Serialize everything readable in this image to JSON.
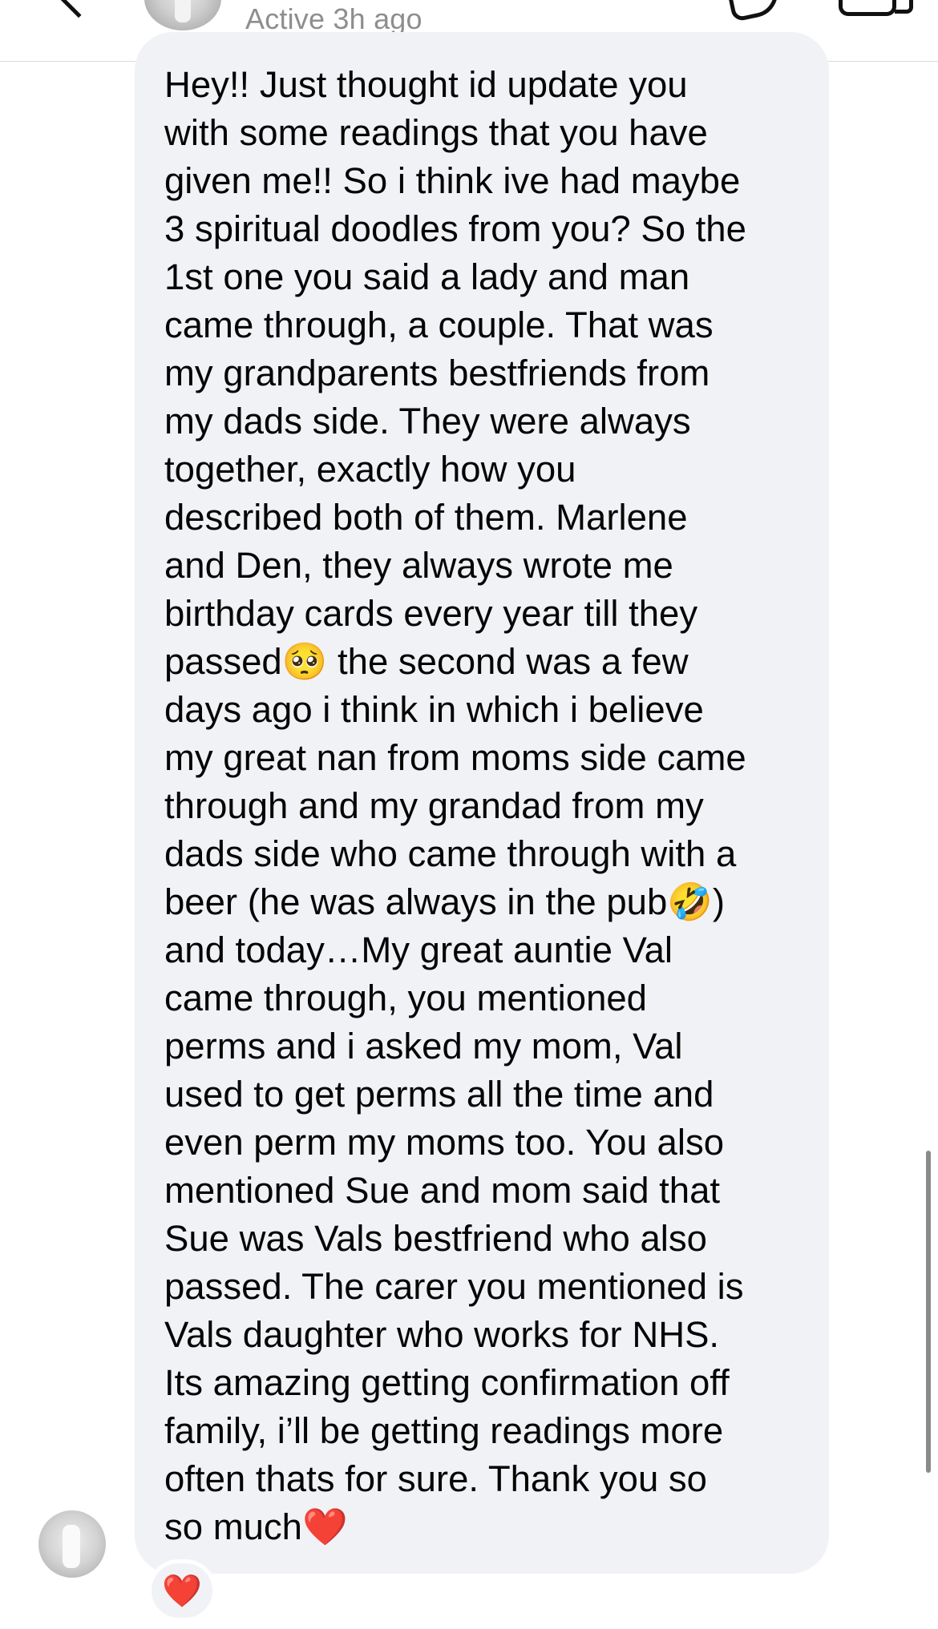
{
  "header": {
    "status": "Active 3h ago",
    "icons": {
      "back": "chevron-left-icon",
      "call": "phone-icon",
      "video": "video-camera-icon"
    }
  },
  "message": {
    "text": "Hey!! Just thought id update you\nwith some readings that you have\ngiven me!! So i think ive had maybe\n3 spiritual doodles from you? So the\n1st one you said a lady and man\ncame through, a couple. That was\nmy grandparents bestfriends from\nmy dads side. They were always\ntogether, exactly how you\ndescribed both of them. Marlene\nand Den, they always wrote me\nbirthday cards every year till they\npassed🥺 the second was a few\ndays ago i think in which i believe\nmy great nan from moms side came\nthrough and my grandad from my\ndads side who came through with a\nbeer (he was always in the pub🤣)\nand today…My great auntie Val\ncame through, you mentioned\nperms and i asked my mom, Val\nused to get perms all the time and\neven perm my moms too. You also\nmentioned Sue and mom said that\nSue was Vals bestfriend who also\npassed. The carer you mentioned is\nVals daughter who works for NHS.\nIts amazing getting confirmation off\nfamily, i’ll be getting readings more\noften thats for sure. Thank you so\nso much❤️",
    "reaction": "❤️"
  },
  "colors": {
    "bubble": "#f1f2f5",
    "status_text": "#8e8e8e",
    "heart": "#e0102a"
  }
}
